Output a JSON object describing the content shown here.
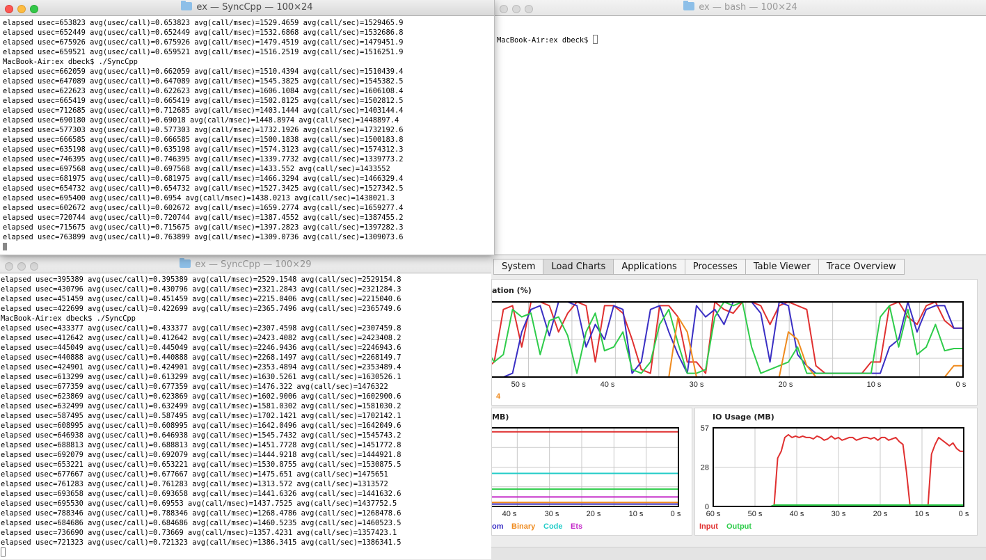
{
  "windows": {
    "top_left": {
      "title": "ex — SyncCpp — 100×24",
      "lines": [
        "elapsed usec=653823 avg(usec/call)=0.653823 avg(call/msec)=1529.4659 avg(call/sec)=1529465.9",
        "elapsed usec=652449 avg(usec/call)=0.652449 avg(call/msec)=1532.6868 avg(call/sec)=1532686.8",
        "elapsed usec=675926 avg(usec/call)=0.675926 avg(call/msec)=1479.4519 avg(call/sec)=1479451.9",
        "elapsed usec=659521 avg(usec/call)=0.659521 avg(call/msec)=1516.2519 avg(call/sec)=1516251.9",
        "MacBook-Air:ex dbeck$ ./SyncCpp",
        "elapsed usec=662059 avg(usec/call)=0.662059 avg(call/msec)=1510.4394 avg(call/sec)=1510439.4",
        "elapsed usec=647089 avg(usec/call)=0.647089 avg(call/msec)=1545.3825 avg(call/sec)=1545382.5",
        "elapsed usec=622623 avg(usec/call)=0.622623 avg(call/msec)=1606.1084 avg(call/sec)=1606108.4",
        "elapsed usec=665419 avg(usec/call)=0.665419 avg(call/msec)=1502.8125 avg(call/sec)=1502812.5",
        "elapsed usec=712685 avg(usec/call)=0.712685 avg(call/msec)=1403.1444 avg(call/sec)=1403144.4",
        "elapsed usec=690180 avg(usec/call)=0.69018 avg(call/msec)=1448.8974 avg(call/sec)=1448897.4",
        "elapsed usec=577303 avg(usec/call)=0.577303 avg(call/msec)=1732.1926 avg(call/sec)=1732192.6",
        "elapsed usec=666585 avg(usec/call)=0.666585 avg(call/msec)=1500.1838 avg(call/sec)=1500183.8",
        "elapsed usec=635198 avg(usec/call)=0.635198 avg(call/msec)=1574.3123 avg(call/sec)=1574312.3",
        "elapsed usec=746395 avg(usec/call)=0.746395 avg(call/msec)=1339.7732 avg(call/sec)=1339773.2",
        "elapsed usec=697568 avg(usec/call)=0.697568 avg(call/msec)=1433.552 avg(call/sec)=1433552",
        "elapsed usec=681975 avg(usec/call)=0.681975 avg(call/msec)=1466.3294 avg(call/sec)=1466329.4",
        "elapsed usec=654732 avg(usec/call)=0.654732 avg(call/msec)=1527.3425 avg(call/sec)=1527342.5",
        "elapsed usec=695400 avg(usec/call)=0.6954 avg(call/msec)=1438.0213 avg(call/sec)=1438021.3",
        "elapsed usec=602672 avg(usec/call)=0.602672 avg(call/msec)=1659.2774 avg(call/sec)=1659277.4",
        "elapsed usec=720744 avg(usec/call)=0.720744 avg(call/msec)=1387.4552 avg(call/sec)=1387455.2",
        "elapsed usec=715675 avg(usec/call)=0.715675 avg(call/msec)=1397.2823 avg(call/sec)=1397282.3",
        "elapsed usec=763899 avg(usec/call)=0.763899 avg(call/msec)=1309.0736 avg(call/sec)=1309073.6"
      ]
    },
    "top_right": {
      "title": "ex — bash — 100×24",
      "prompt": "MacBook-Air:ex dbeck$ "
    },
    "bottom_left": {
      "title": "ex — SyncCpp — 100×29",
      "lines": [
        "elapsed usec=395389 avg(usec/call)=0.395389 avg(call/msec)=2529.1548 avg(call/sec)=2529154.8",
        "elapsed usec=430796 avg(usec/call)=0.430796 avg(call/msec)=2321.2843 avg(call/sec)=2321284.3",
        "elapsed usec=451459 avg(usec/call)=0.451459 avg(call/msec)=2215.0406 avg(call/sec)=2215040.6",
        "elapsed usec=422699 avg(usec/call)=0.422699 avg(call/msec)=2365.7496 avg(call/sec)=2365749.6",
        "MacBook-Air:ex dbeck$ ./SyncCpp",
        "elapsed usec=433377 avg(usec/call)=0.433377 avg(call/msec)=2307.4598 avg(call/sec)=2307459.8",
        "elapsed usec=412642 avg(usec/call)=0.412642 avg(call/msec)=2423.4082 avg(call/sec)=2423408.2",
        "elapsed usec=445049 avg(usec/call)=0.445049 avg(call/msec)=2246.9436 avg(call/sec)=2246943.6",
        "elapsed usec=440888 avg(usec/call)=0.440888 avg(call/msec)=2268.1497 avg(call/sec)=2268149.7",
        "elapsed usec=424901 avg(usec/call)=0.424901 avg(call/msec)=2353.4894 avg(call/sec)=2353489.4",
        "elapsed usec=613299 avg(usec/call)=0.613299 avg(call/msec)=1630.5261 avg(call/sec)=1630526.1",
        "elapsed usec=677359 avg(usec/call)=0.677359 avg(call/msec)=1476.322 avg(call/sec)=1476322",
        "elapsed usec=623869 avg(usec/call)=0.623869 avg(call/msec)=1602.9006 avg(call/sec)=1602900.6",
        "elapsed usec=632499 avg(usec/call)=0.632499 avg(call/msec)=1581.0302 avg(call/sec)=1581030.2",
        "elapsed usec=587495 avg(usec/call)=0.587495 avg(call/msec)=1702.1421 avg(call/sec)=1702142.1",
        "elapsed usec=608995 avg(usec/call)=0.608995 avg(call/msec)=1642.0496 avg(call/sec)=1642049.6",
        "elapsed usec=646938 avg(usec/call)=0.646938 avg(call/msec)=1545.7432 avg(call/sec)=1545743.2",
        "elapsed usec=688813 avg(usec/call)=0.688813 avg(call/msec)=1451.7728 avg(call/sec)=1451772.8",
        "elapsed usec=692079 avg(usec/call)=0.692079 avg(call/msec)=1444.9218 avg(call/sec)=1444921.8",
        "elapsed usec=653221 avg(usec/call)=0.653221 avg(call/msec)=1530.8755 avg(call/sec)=1530875.5",
        "elapsed usec=677667 avg(usec/call)=0.677667 avg(call/msec)=1475.651 avg(call/sec)=1475651",
        "elapsed usec=761283 avg(usec/call)=0.761283 avg(call/msec)=1313.572 avg(call/sec)=1313572",
        "elapsed usec=693658 avg(usec/call)=0.693658 avg(call/msec)=1441.6326 avg(call/sec)=1441632.6",
        "elapsed usec=695530 avg(usec/call)=0.69553 avg(call/msec)=1437.7525 avg(call/sec)=1437752.5",
        "elapsed usec=788346 avg(usec/call)=0.788346 avg(call/msec)=1268.4786 avg(call/sec)=1268478.6",
        "elapsed usec=684686 avg(usec/call)=0.684686 avg(call/msec)=1460.5235 avg(call/sec)=1460523.5",
        "elapsed usec=736690 avg(usec/call)=0.73669 avg(call/msec)=1357.4231 avg(call/sec)=1357423.1",
        "elapsed usec=721323 avg(usec/call)=0.721323 avg(call/msec)=1386.3415 avg(call/sec)=1386341.5"
      ]
    }
  },
  "monitor": {
    "tabs": [
      "System",
      "Load Charts",
      "Applications",
      "Processes",
      "Table Viewer",
      "Trace Overview"
    ],
    "selected_tab": "Load Charts",
    "colors": {
      "red": "#e03030",
      "blue": "#3a2fc4",
      "green": "#2ecc4a",
      "orange": "#ef8a1d",
      "cyan": "#22ccc8",
      "magenta": "#c326c8"
    }
  },
  "chart_data": [
    {
      "type": "line",
      "title": "ation (%)",
      "x_ticks": [
        "50 s",
        "40 s",
        "30 s",
        "20 s",
        "10 s",
        "0 s"
      ],
      "legend_fragment": "4",
      "series": [
        {
          "color": "#e03030",
          "values": [
            10,
            20,
            90,
            95,
            40,
            100,
            100,
            95,
            60,
            85,
            100,
            95,
            20,
            95,
            95,
            85,
            50,
            10,
            5,
            95,
            95,
            80,
            20,
            20,
            5,
            100,
            90,
            85,
            100,
            100,
            95,
            70,
            95,
            100,
            95,
            90,
            15,
            5,
            5,
            5,
            5,
            5,
            20,
            20,
            95,
            100,
            80,
            70,
            95,
            100,
            75,
            65,
            65
          ]
        },
        {
          "color": "#3a2fc4",
          "values": [
            0,
            0,
            0,
            5,
            60,
            90,
            95,
            55,
            100,
            100,
            95,
            40,
            70,
            50,
            95,
            90,
            5,
            20,
            90,
            95,
            60,
            30,
            5,
            95,
            80,
            90,
            70,
            100,
            100,
            100,
            85,
            20,
            100,
            95,
            30,
            15,
            5,
            5,
            5,
            5,
            5,
            5,
            5,
            5,
            40,
            50,
            100,
            60,
            90,
            95,
            95,
            65,
            65
          ]
        },
        {
          "color": "#2ecc4a",
          "values": [
            40,
            20,
            30,
            90,
            80,
            85,
            30,
            75,
            80,
            55,
            5,
            60,
            85,
            35,
            40,
            60,
            10,
            5,
            20,
            70,
            90,
            45,
            5,
            5,
            10,
            80,
            100,
            95,
            100,
            40,
            5,
            10,
            15,
            20,
            40,
            5,
            5,
            5,
            5,
            5,
            5,
            5,
            5,
            80,
            95,
            40,
            90,
            30,
            40,
            70,
            35,
            38,
            38
          ]
        },
        {
          "color": "#ef8a1d",
          "values": [
            0,
            0,
            0,
            0,
            0,
            0,
            0,
            0,
            0,
            0,
            0,
            0,
            0,
            0,
            0,
            0,
            0,
            0,
            0,
            0,
            0,
            80,
            60,
            0,
            0,
            0,
            0,
            0,
            0,
            0,
            0,
            0,
            0,
            60,
            50,
            15,
            0,
            0,
            0,
            0,
            0,
            0,
            0,
            0,
            0,
            0,
            0,
            0,
            0,
            0,
            0,
            15,
            15
          ]
        }
      ],
      "ylim": [
        0,
        100
      ]
    },
    {
      "type": "line",
      "title": "MB)",
      "x_ticks": [
        "40 s",
        "30 s",
        "20 s",
        "10 s",
        "0 s"
      ],
      "legend": [
        "om",
        "Binary",
        "Code",
        "Ets"
      ],
      "series": [
        {
          "color": "#e03030",
          "values": [
            95,
            95,
            95,
            95,
            95,
            95,
            95,
            95,
            95,
            95,
            95
          ]
        },
        {
          "color": "#22ccc8",
          "values": [
            42,
            42,
            42,
            42,
            42,
            42,
            42,
            42,
            42,
            42,
            42
          ]
        },
        {
          "color": "#2ecc4a",
          "values": [
            22,
            22,
            22,
            22,
            22,
            22,
            22,
            22,
            22,
            22,
            22
          ]
        },
        {
          "color": "#c326c8",
          "values": [
            12,
            12,
            12,
            12,
            12,
            12,
            12,
            12,
            12,
            12,
            12
          ]
        },
        {
          "color": "#ef8a1d",
          "values": [
            5,
            5,
            5,
            5,
            5,
            5,
            5,
            5,
            5,
            5,
            5
          ]
        },
        {
          "color": "#3a2fc4",
          "values": [
            3,
            3,
            3,
            3,
            3,
            3,
            3,
            3,
            3,
            3,
            3
          ]
        }
      ],
      "ylim": [
        0,
        100
      ]
    },
    {
      "type": "line",
      "title": "IO Usage (MB)",
      "y_ticks": [
        "57",
        "28",
        "0"
      ],
      "x_ticks": [
        "60 s",
        "50 s",
        "40 s",
        "30 s",
        "20 s",
        "10 s",
        "0 s"
      ],
      "legend": [
        "Input",
        "Output"
      ],
      "series": [
        {
          "name": "Input",
          "color": "#e03030",
          "values": [
            0,
            0,
            0,
            0,
            0,
            0,
            0,
            0,
            0,
            0,
            0,
            0,
            0,
            0,
            0,
            0,
            0,
            0,
            35,
            40,
            50,
            52,
            50,
            51,
            50,
            51,
            50,
            50,
            49,
            51,
            50,
            48,
            49,
            51,
            49,
            50,
            48,
            49,
            50,
            50,
            48,
            49,
            50,
            50,
            49,
            50,
            48,
            50,
            50,
            48,
            49,
            50,
            47,
            45,
            25,
            0,
            0,
            0,
            0,
            0,
            0,
            38,
            45,
            50,
            48,
            46,
            44,
            46,
            42,
            40,
            40
          ]
        },
        {
          "name": "Output",
          "color": "#2ecc4a",
          "values": [
            0,
            0,
            0,
            0,
            0,
            0,
            0,
            0,
            0,
            0,
            0,
            0,
            0,
            0,
            0,
            0,
            0,
            1,
            1,
            1,
            1,
            1,
            1,
            1,
            1,
            1,
            1,
            1,
            1,
            1,
            1,
            1,
            1,
            1,
            1,
            1,
            1,
            1,
            1,
            1,
            1,
            1,
            1,
            1,
            1,
            1,
            1,
            1,
            1,
            1,
            1,
            1,
            1,
            1,
            1,
            1,
            1,
            1,
            1,
            1,
            1,
            1,
            1,
            1,
            1,
            1,
            1,
            1,
            1,
            1,
            1
          ]
        }
      ],
      "ylim": [
        0,
        57
      ]
    }
  ]
}
